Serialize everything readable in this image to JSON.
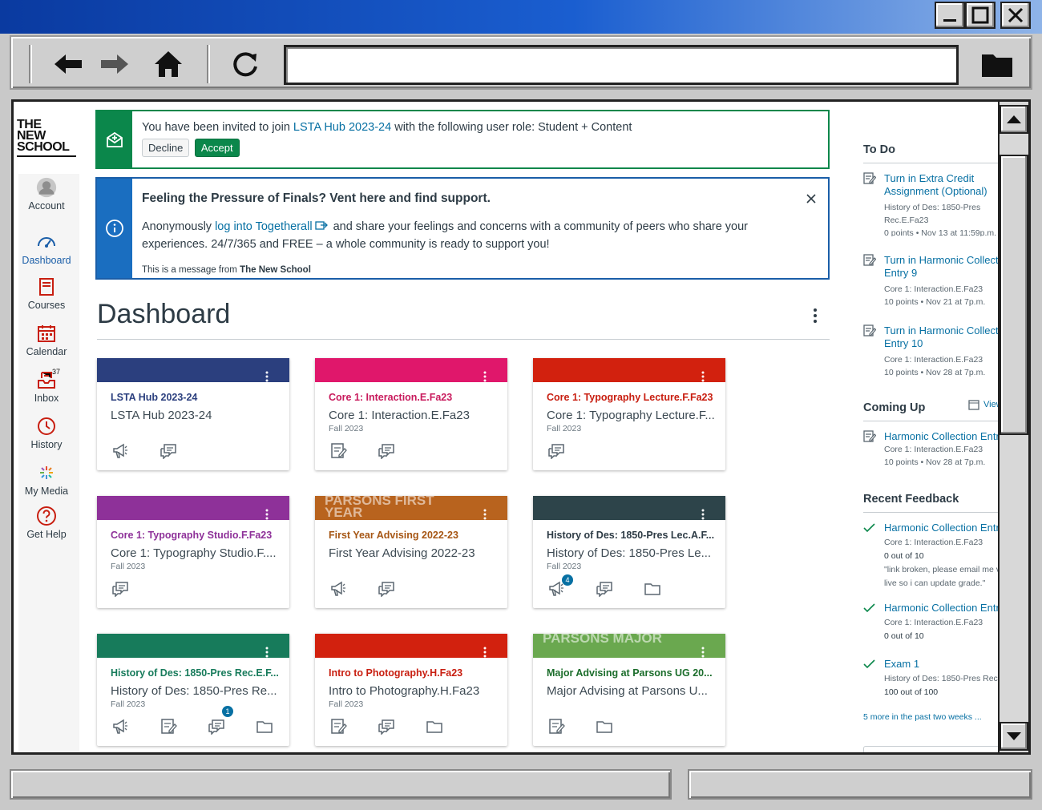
{
  "nav": {
    "account": "Account",
    "dashboard": "Dashboard",
    "courses": "Courses",
    "calendar": "Calendar",
    "inbox": "Inbox",
    "inbox_count": "37",
    "history": "History",
    "my_media": "My Media",
    "get_help": "Get Help"
  },
  "logo": {
    "line1": "THE",
    "line2": "NEW",
    "line3": "SCHOOL"
  },
  "invite": {
    "pre": "You have been invited to join ",
    "course": "LSTA Hub 2023-24",
    "post": " with the following user role: Student + Content",
    "decline": "Decline",
    "accept": "Accept"
  },
  "notice": {
    "title": "Feeling the Pressure of Finals? Vent here and find support.",
    "pre": "Anonymously ",
    "link": "log into Togetherall",
    "post1": " and share your feelings and concerns with a community of peers who share your",
    "post2": "experiences. 24/7/365 and FREE – a whole community is ready to support you!",
    "from_pre": "This is a message from ",
    "from": "The New School"
  },
  "dashboard": {
    "title": "Dashboard"
  },
  "cards": [
    {
      "title": "LSTA Hub 2023-24",
      "sub": "LSTA Hub 2023-24",
      "term": "",
      "color": "#2b3f7e",
      "titlecolor": "#2b3f7e",
      "hero_text": ""
    },
    {
      "title": "Core 1: Interaction.E.Fa23",
      "sub": "Core 1: Interaction.E.Fa23",
      "term": "Fall 2023",
      "color": "#e0176b",
      "titlecolor": "#c81a5c",
      "hero_text": ""
    },
    {
      "title": "Core 1: Typography Lecture.F.Fa23",
      "sub": "Core 1: Typography Lecture.F...",
      "term": "Fall 2023",
      "color": "#d2210e",
      "titlecolor": "#c81e10",
      "hero_text": ""
    },
    {
      "title": "Core 1: Typography Studio.F.Fa23",
      "sub": "Core 1: Typography Studio.F....",
      "term": "Fall 2023",
      "color": "#8e3199",
      "titlecolor": "#8e3199",
      "hero_text": ""
    },
    {
      "title": "First Year Advising 2022-23",
      "sub": "First Year Advising 2022-23",
      "term": "",
      "color": "#b8631e",
      "titlecolor": "#a65614",
      "hero_text": "PARSONS FIRST YEAR"
    },
    {
      "title": "History of Des: 1850-Pres Lec.A.F...",
      "sub": "History of Des: 1850-Pres Le...",
      "term": "Fall 2023",
      "color": "#2d444a",
      "titlecolor": "#2d3b45",
      "hero_text": ""
    },
    {
      "title": "History of Des: 1850-Pres Rec.E.F...",
      "sub": "History of Des: 1850-Pres Re...",
      "term": "Fall 2023",
      "color": "#177b5b",
      "titlecolor": "#177b5b",
      "hero_text": ""
    },
    {
      "title": "Intro to Photography.H.Fa23",
      "sub": "Intro to Photography.H.Fa23",
      "term": "Fall 2023",
      "color": "#d2210e",
      "titlecolor": "#c81e10",
      "hero_text": ""
    },
    {
      "title": "Major Advising at Parsons UG 20...",
      "sub": "Major Advising at Parsons U...",
      "term": "",
      "color": "#6aa84f",
      "titlecolor": "#1b6d2b",
      "hero_text": "PARSONS MAJOR"
    }
  ],
  "badges": {
    "history_lec": "4",
    "history_rec": "1"
  },
  "todo": {
    "heading": "To Do",
    "items": [
      {
        "title1": "Turn in Extra Credit",
        "title2": "Assignment (Optional)",
        "m1": "History of Des: 1850-Pres",
        "m2": "Rec.E.Fa23",
        "m3": "0 points • Nov 13 at 11:59p.m."
      },
      {
        "title1": "Turn in Harmonic Collecti",
        "title2": "Entry 9",
        "m1": "Core 1: Interaction.E.Fa23",
        "m2": "10 points • Nov 21 at 7p.m."
      },
      {
        "title1": "Turn in Harmonic Collecti",
        "title2": "Entry 10",
        "m1": "Core 1: Interaction.E.Fa23",
        "m2": "10 points • Nov 28 at 7p.m."
      }
    ]
  },
  "coming": {
    "heading": "Coming Up",
    "view": "View",
    "item": {
      "title": "Harmonic Collection Entr",
      "m1": "Core 1: Interaction.E.Fa23",
      "m2": "10 points • Nov 28 at 7p.m."
    }
  },
  "feedback": {
    "heading": "Recent Feedback",
    "items": [
      {
        "title": "Harmonic Collection Entr",
        "m1": "Core 1: Interaction.E.Fa23",
        "m2": "0 out of 10",
        "m3": "\"link broken, please email me v",
        "m4": "live so i can update grade.\""
      },
      {
        "title": "Harmonic Collection Entr",
        "m1": "Core 1: Interaction.E.Fa23",
        "m2": "0 out of 10"
      },
      {
        "title": "Exam 1",
        "m1": "History of Des: 1850-Pres Rec",
        "m2": "100 out of 100"
      }
    ],
    "more": "5 more in the past two weeks ..."
  }
}
